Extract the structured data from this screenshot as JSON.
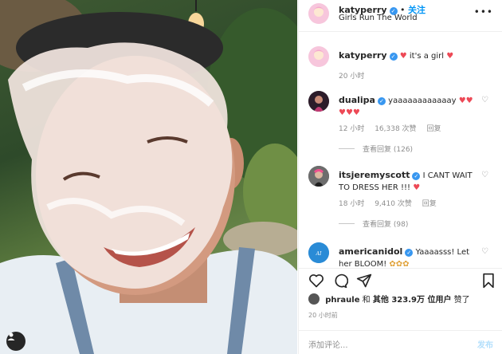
{
  "post": {
    "author": "katyperry",
    "follow_sep": "•",
    "follow_label": "关注",
    "location": "Girls Run The World",
    "more_icon": "more-horizontal-icon"
  },
  "caption": {
    "author": "katyperry",
    "text": "it's a girl",
    "time": "20 小时"
  },
  "comments": [
    {
      "author": "dualipa",
      "text": "yaaaaaaaaaaaay",
      "time": "12 小时",
      "likes": "16,338 次赞",
      "reply": "回复",
      "view_replies": "查看回复 (126)"
    },
    {
      "author": "itsjeremyscott",
      "text": "I CANT WAIT TO DRESS HER !!!",
      "time": "18 小时",
      "likes": "9,410 次赞",
      "reply": "回复",
      "view_replies": "查看回复 (98)"
    },
    {
      "author": "americanidol",
      "text": "Yaaaasss! Let her BLOOM!"
    }
  ],
  "likes": {
    "user": "phraule",
    "and": "和",
    "others": "其他 323.9万 位用户",
    "liked": "赞了"
  },
  "timestamp": "20 小时前",
  "comment_box": {
    "placeholder": "添加评论...",
    "post_label": "发布"
  },
  "colors": {
    "accent": "#0095f6",
    "verified": "#3897f0",
    "heart": "#ed4956"
  }
}
